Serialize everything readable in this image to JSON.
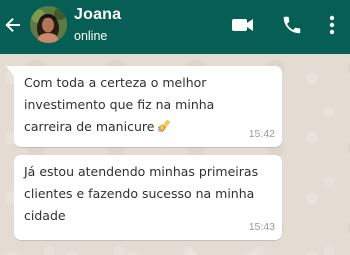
{
  "header": {
    "contact_name": "Joana",
    "status": "online",
    "background_color": "#075e54",
    "icons": [
      "back-arrow-icon",
      "video-call-icon",
      "phone-icon",
      "more-options-icon"
    ]
  },
  "messages": [
    {
      "text": "Com toda a certeza o melhor\ninvestimento que fiz na minha\ncarreira de manicure",
      "emoji": "nail-polish-icon",
      "time": "15:42"
    },
    {
      "text": "Já estou atendendo minhas primeiras\nclientes e fazendo sucesso na minha\ncidade",
      "time": "15:43"
    }
  ],
  "colors": {
    "chat_background": "#e4dcd3",
    "bubble": "#ffffff",
    "text": "#303030",
    "timestamp": "#999999"
  }
}
